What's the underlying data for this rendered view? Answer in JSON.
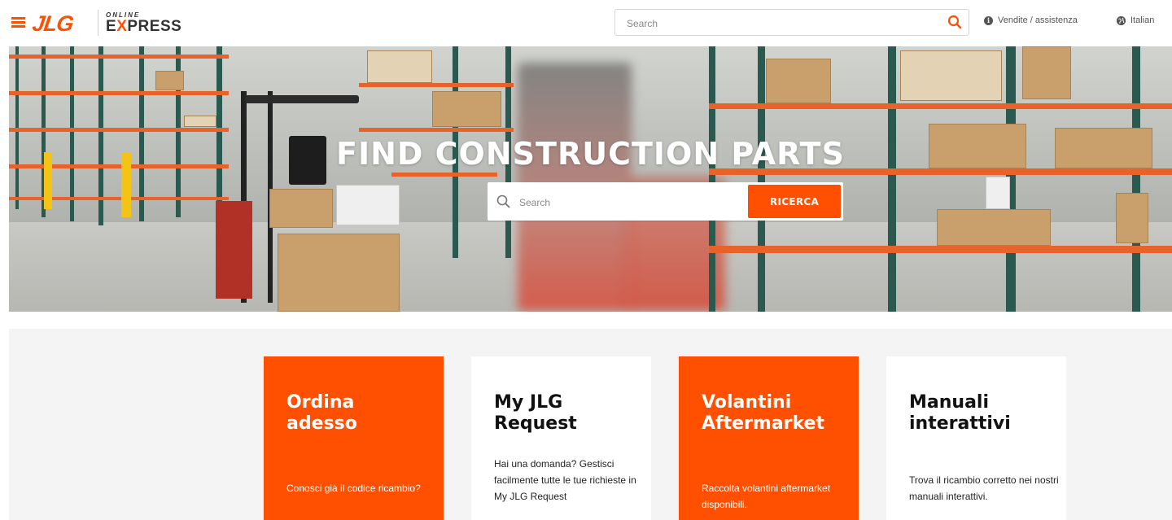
{
  "header": {
    "brand_main": "JLG",
    "brand_online": "ONLINE",
    "brand_express_pre": "E",
    "brand_express_x": "X",
    "brand_express_post": "PRESS",
    "search_placeholder": "Search",
    "sales_link": "Vendite / assistenza",
    "language": "Italian"
  },
  "hero": {
    "title": "FIND CONSTRUCTION PARTS",
    "search_placeholder": "Search",
    "search_button": "RICERCA"
  },
  "cards": [
    {
      "title": "Ordina adesso",
      "text": "Conosci già il codice ricambio?",
      "style": "orange"
    },
    {
      "title": "My JLG Request",
      "text": "Hai una domanda? Gestisci facilmente tutte le tue richieste in My JLG Request",
      "style": "white"
    },
    {
      "title": "Volantini Aftermarket",
      "text": "Raccolta  volantini aftermarket disponibili.",
      "style": "orange"
    },
    {
      "title": "Manuali interattivi",
      "text": "Trova il ricambio corretto nei nostri manuali interattivi.",
      "style": "white"
    }
  ],
  "colors": {
    "accent": "#fe5000",
    "text_dark": "#111111",
    "card_area_bg": "#f4f4f4"
  },
  "icons": {
    "menu": "hamburger-icon",
    "search": "search-icon",
    "info": "info-icon",
    "globe": "globe-icon"
  }
}
